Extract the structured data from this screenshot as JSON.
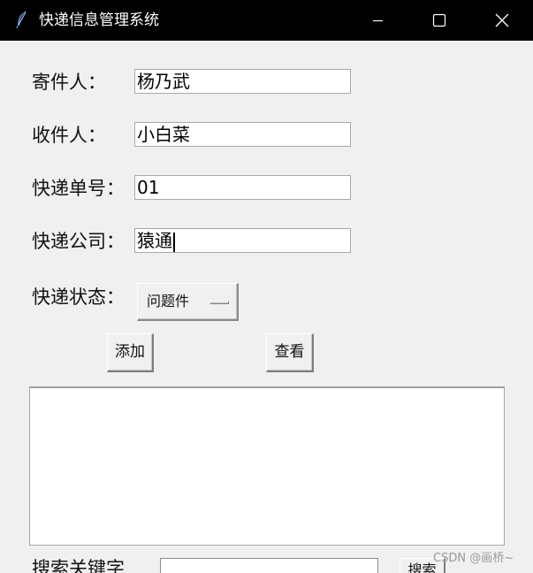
{
  "window": {
    "title": "快递信息管理系统"
  },
  "form": {
    "sender_label": "寄件人：",
    "sender_value": "杨乃武",
    "receiver_label": "收件人：",
    "receiver_value": "小白菜",
    "tracking_label": "快递单号：",
    "tracking_value": "01",
    "company_label": "快递公司：",
    "company_value": "猿通",
    "status_label": "快递状态：",
    "status_selected": "问题件"
  },
  "actions": {
    "add_label": "添加",
    "view_label": "查看"
  },
  "search": {
    "label": "搜索关键字",
    "button_label": "搜索"
  },
  "watermark": "CSDN @画桥~",
  "icons": {
    "app": "feather-icon",
    "minimize": "minimize-icon",
    "maximize": "maximize-icon",
    "close": "close-icon"
  },
  "colors": {
    "titlebar": "#000000",
    "window_bg": "#f0f0f0",
    "field_bg": "#ffffff"
  }
}
